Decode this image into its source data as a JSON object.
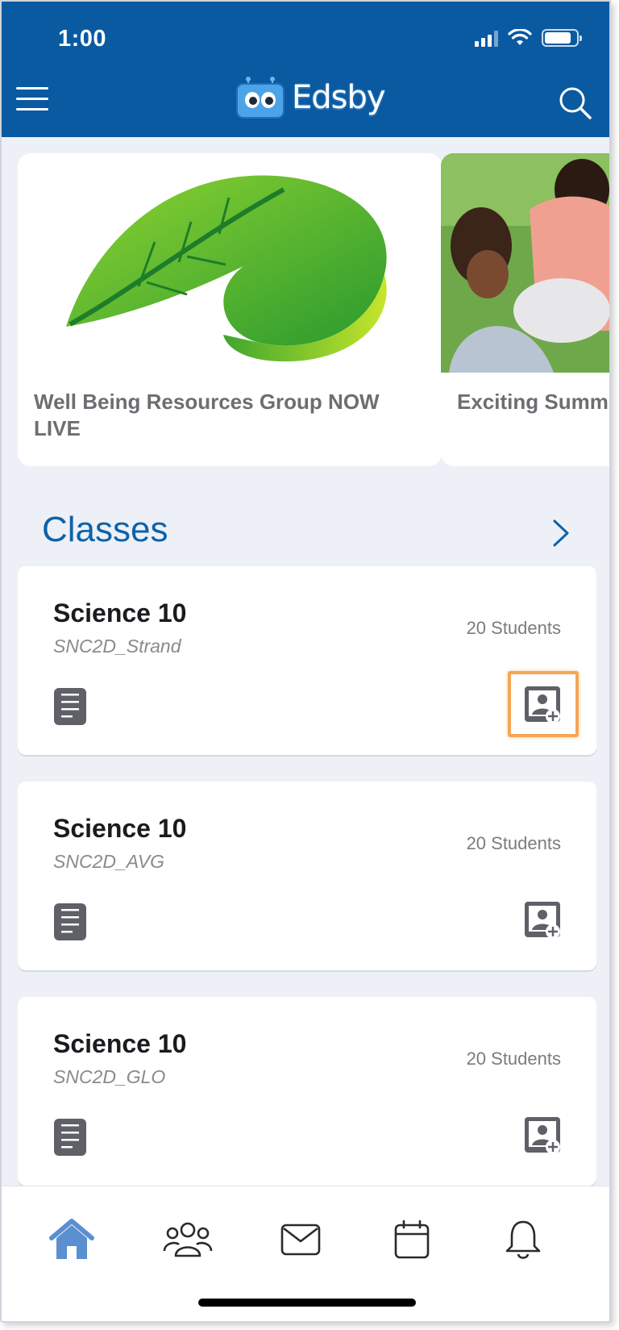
{
  "status_bar": {
    "time": "1:00"
  },
  "header": {
    "logo_text": "Edsby",
    "menu_icon": "hamburger-menu-icon",
    "search_icon": "search-icon"
  },
  "news": [
    {
      "title": "Well Being Resources Group NOW LIVE"
    },
    {
      "title": "Exciting Summer Opportunities"
    }
  ],
  "classes": {
    "title": "Classes",
    "items": [
      {
        "name": "Science 10",
        "code": "SNC2D_Strand",
        "students": "20 Students",
        "highlighted": true
      },
      {
        "name": "Science 10",
        "code": "SNC2D_AVG",
        "students": "20 Students",
        "highlighted": false
      },
      {
        "name": "Science 10",
        "code": "SNC2D_GLO",
        "students": "20 Students",
        "highlighted": false
      }
    ]
  },
  "tabbar": {
    "items": [
      "home-icon",
      "people-icon",
      "mail-icon",
      "calendar-icon",
      "bell-icon"
    ],
    "active": "home-icon",
    "active_color": "#5a8fd1",
    "inactive_color": "#2a2a2e"
  },
  "colors": {
    "brand": "#0a5aa2",
    "accent": "#0f62a8",
    "highlight": "#f3a654"
  }
}
